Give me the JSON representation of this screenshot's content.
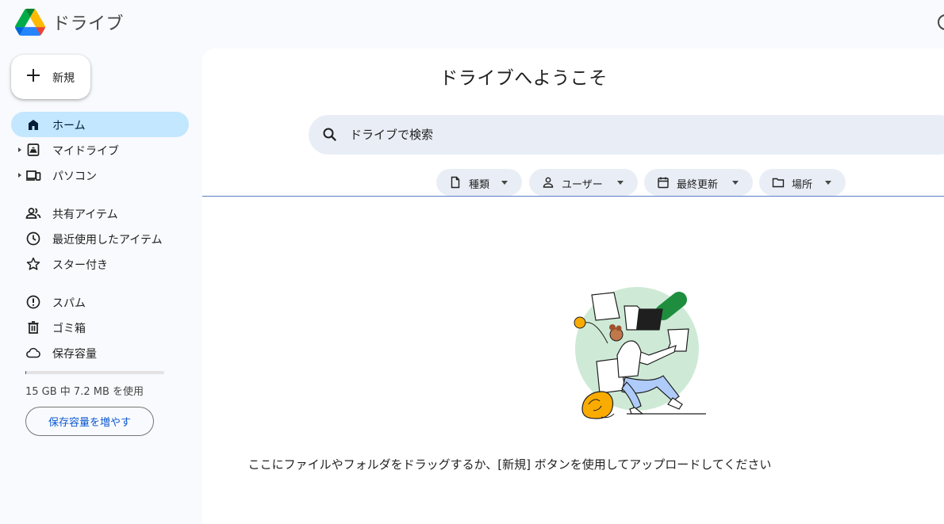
{
  "app": {
    "title": "ドライブ",
    "logo_icon": "google-drive-logo"
  },
  "sidebar": {
    "new_button": {
      "label": "新規",
      "icon": "plus-icon"
    },
    "items": [
      {
        "label": "ホーム",
        "icon": "home-icon",
        "active": true,
        "expandable": false
      },
      {
        "label": "マイドライブ",
        "icon": "my-drive-icon",
        "active": false,
        "expandable": true
      },
      {
        "label": "パソコン",
        "icon": "computers-icon",
        "active": false,
        "expandable": true
      },
      {
        "label": "共有アイテム",
        "icon": "shared-users-icon",
        "active": false,
        "expandable": false
      },
      {
        "label": "最近使用したアイテム",
        "icon": "clock-icon",
        "active": false,
        "expandable": false
      },
      {
        "label": "スター付き",
        "icon": "star-icon",
        "active": false,
        "expandable": false
      },
      {
        "label": "スパム",
        "icon": "spam-icon",
        "active": false,
        "expandable": false
      },
      {
        "label": "ゴミ箱",
        "icon": "trash-icon",
        "active": false,
        "expandable": false
      },
      {
        "label": "保存容量",
        "icon": "cloud-icon",
        "active": false,
        "expandable": false
      }
    ],
    "storage": {
      "usage_text": "15 GB 中 7.2 MB を使用",
      "used_fraction": 0.0005,
      "upgrade_label": "保存容量を増やす"
    }
  },
  "main": {
    "welcome_title": "ドライブへようこそ",
    "search": {
      "placeholder": "ドライブで検索",
      "value": ""
    },
    "filters": [
      {
        "label": "種類",
        "icon": "file-icon"
      },
      {
        "label": "ユーザー",
        "icon": "person-icon"
      },
      {
        "label": "最終更新",
        "icon": "calendar-icon"
      },
      {
        "label": "場所",
        "icon": "folder-icon"
      }
    ],
    "empty_state_text": "ここにファイルやフォルダをドラッグするか、[新規] ボタンを使用してアップロードしてください"
  },
  "colors": {
    "background": "#f8fafd",
    "active_nav": "#c2e7ff",
    "chip_bg": "#e9eef6",
    "accent": "#0b57d0"
  }
}
